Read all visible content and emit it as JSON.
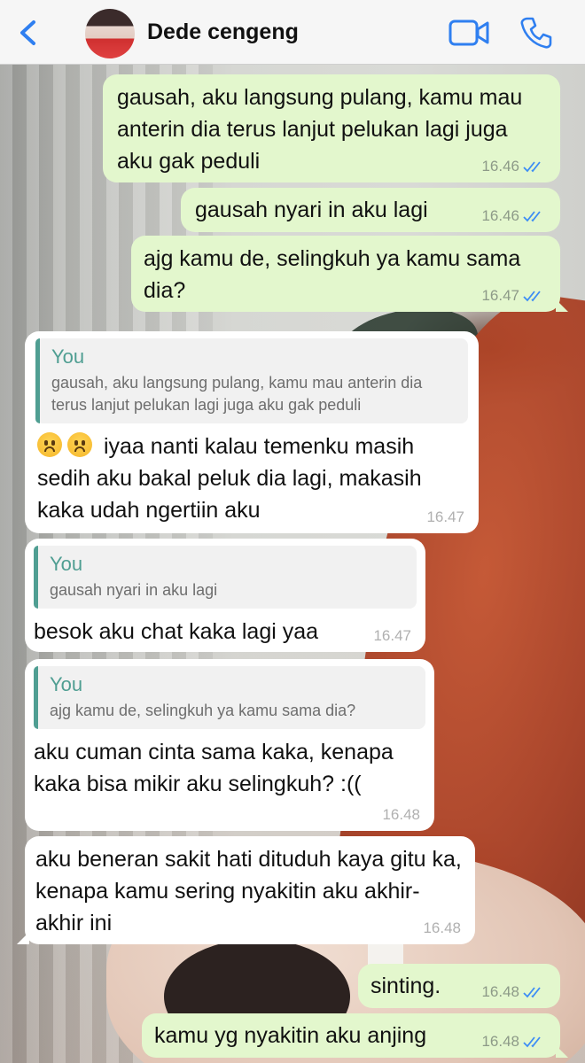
{
  "header": {
    "contact_name": "Dede cengeng",
    "icons": [
      "back-chevron-icon",
      "contact-avatar",
      "video-call-icon",
      "phone-call-icon"
    ]
  },
  "colors": {
    "accent": "#2f7ff0",
    "outgoing_bubble": "#e3f7cd",
    "incoming_bubble": "#ffffff",
    "quote_accent": "#4f9e92"
  },
  "messages": [
    {
      "direction": "outgoing",
      "text": "gausah, aku langsung pulang, kamu mau anterin dia terus lanjut pelukan lagi juga aku gak peduli",
      "time": "16.46",
      "status": "read"
    },
    {
      "direction": "outgoing",
      "text": "gausah nyari in aku lagi",
      "time": "16.46",
      "status": "read"
    },
    {
      "direction": "outgoing",
      "text": "ajg kamu de, selingkuh ya kamu sama dia?",
      "time": "16.47",
      "status": "read"
    },
    {
      "direction": "incoming",
      "quote_name": "You",
      "quote_text": "gausah, aku langsung pulang, kamu mau anterin dia terus lanjut pelukan lagi juga aku gak peduli",
      "emoji": "☹☹",
      "text": "iyaa nanti kalau temenku masih sedih aku bakal peluk dia lagi, makasih kaka udah ngertiin aku",
      "time": "16.47"
    },
    {
      "direction": "incoming",
      "quote_name": "You",
      "quote_text": "gausah nyari in aku lagi",
      "text": "besok aku chat kaka lagi yaa",
      "time": "16.47"
    },
    {
      "direction": "incoming",
      "quote_name": "You",
      "quote_text": "ajg kamu de, selingkuh ya kamu sama dia?",
      "text": "aku cuman cinta sama kaka, kenapa kaka bisa mikir aku selingkuh? :((",
      "time": "16.48"
    },
    {
      "direction": "incoming",
      "text": "aku beneran sakit hati dituduh kaya gitu ka, kenapa kamu sering nyakitin aku akhir-akhir ini",
      "time": "16.48"
    },
    {
      "direction": "outgoing",
      "text": "sinting.",
      "time": "16.48",
      "status": "read"
    },
    {
      "direction": "outgoing",
      "text": "kamu yg nyakitin aku anjing",
      "time": "16.48",
      "status": "read"
    }
  ]
}
